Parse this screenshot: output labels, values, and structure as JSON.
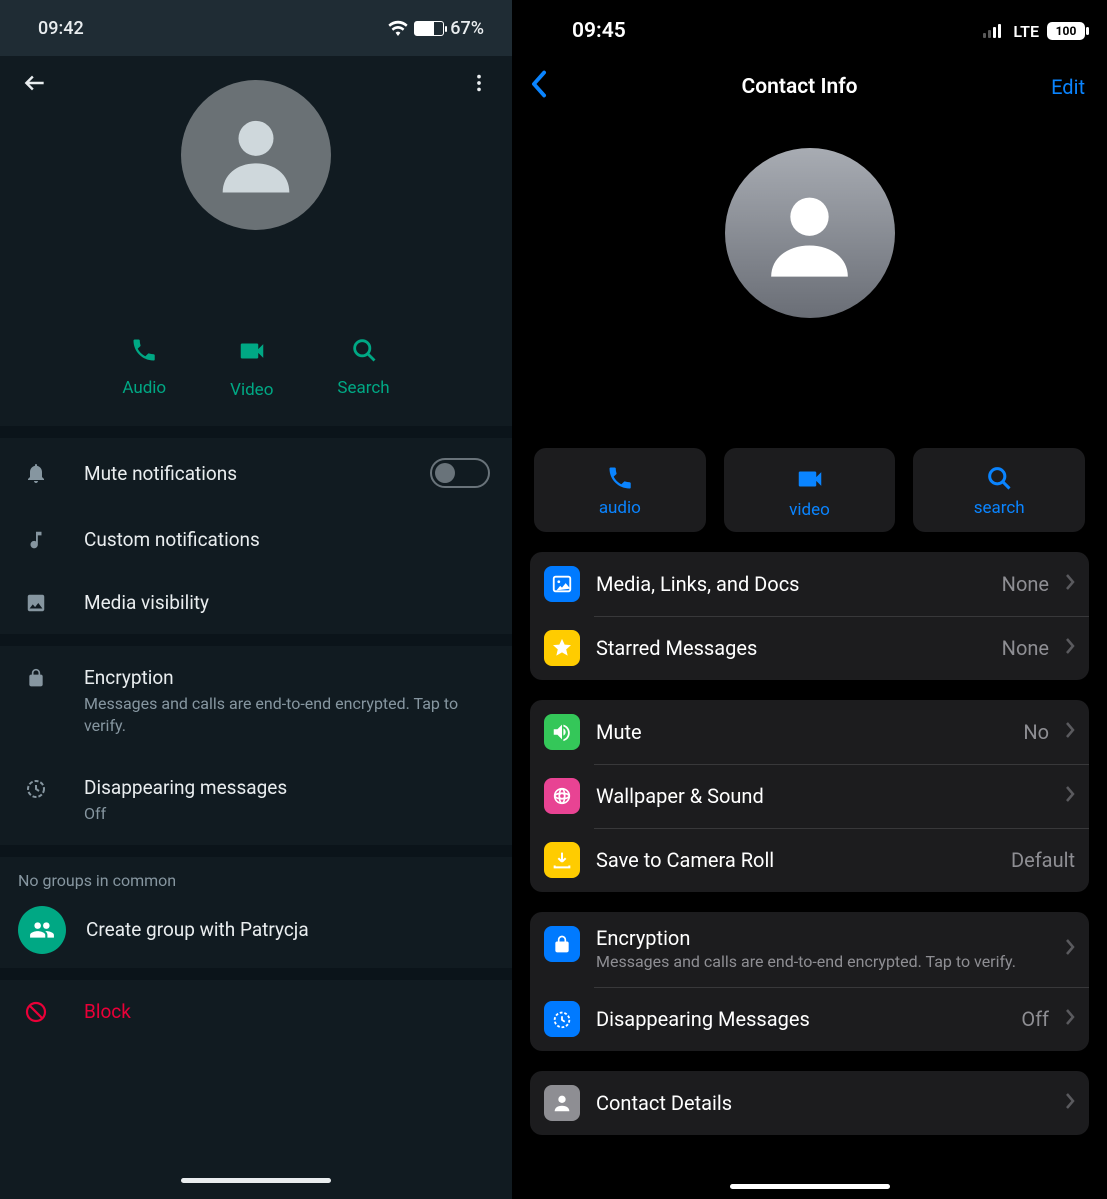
{
  "left": {
    "status": {
      "time": "09:42",
      "battery": "67%"
    },
    "actions": {
      "audio": "Audio",
      "video": "Video",
      "search": "Search"
    },
    "rows": {
      "mute": "Mute notifications",
      "custom": "Custom notifications",
      "media": "Media visibility",
      "encryption_title": "Encryption",
      "encryption_sub": "Messages and calls are end-to-end encrypted. Tap to verify.",
      "disappearing_title": "Disappearing messages",
      "disappearing_sub": "Off"
    },
    "groups": {
      "caption": "No groups in common",
      "create": "Create group with Patrycja"
    },
    "block": "Block"
  },
  "right": {
    "status": {
      "time": "09:45",
      "network": "LTE",
      "battery": "100"
    },
    "nav": {
      "title": "Contact Info",
      "edit": "Edit"
    },
    "actions": {
      "audio": "audio",
      "video": "video",
      "search": "search"
    },
    "group1": {
      "media_label": "Media, Links, and Docs",
      "media_value": "None",
      "starred_label": "Starred Messages",
      "starred_value": "None"
    },
    "group2": {
      "mute_label": "Mute",
      "mute_value": "No",
      "wallpaper_label": "Wallpaper & Sound",
      "save_label": "Save to Camera Roll",
      "save_value": "Default"
    },
    "group3": {
      "encryption_title": "Encryption",
      "encryption_sub": "Messages and calls are end-to-end encrypted. Tap to verify.",
      "disappearing_label": "Disappearing Messages",
      "disappearing_value": "Off"
    },
    "group4": {
      "contact_details": "Contact Details"
    }
  }
}
